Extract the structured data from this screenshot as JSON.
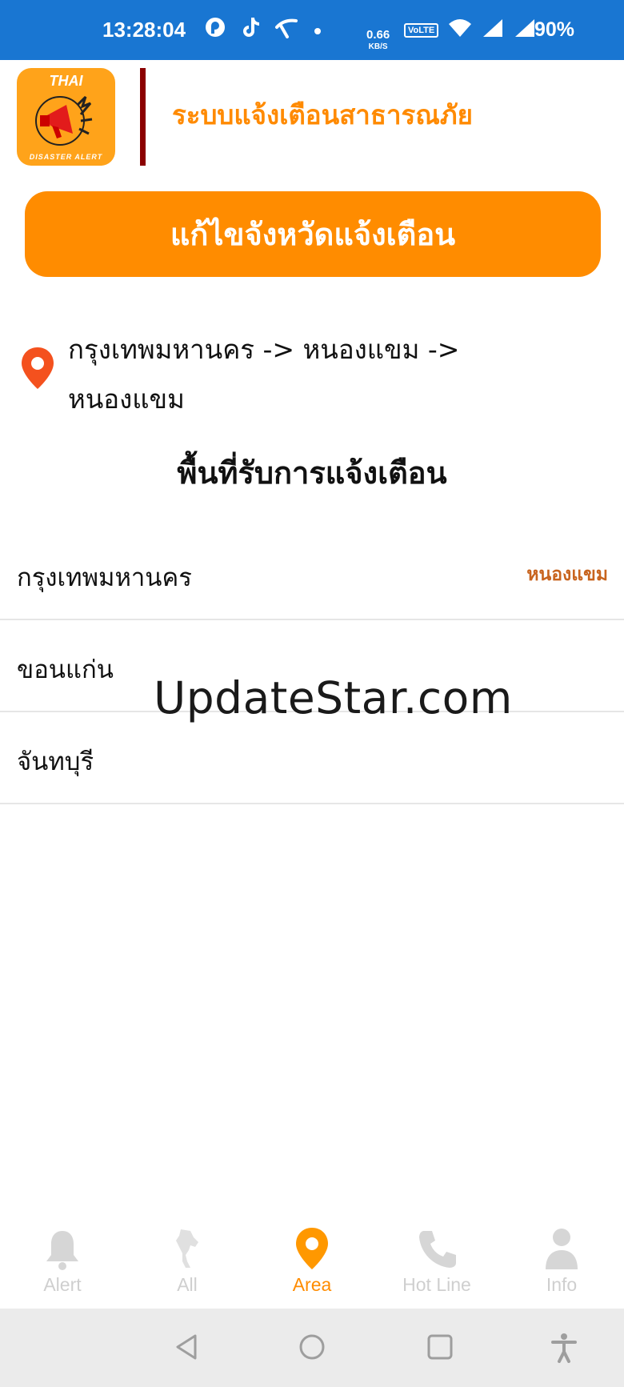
{
  "status_bar": {
    "time": "13:28:04",
    "net_speed_value": "0.66",
    "net_speed_unit": "KB/S",
    "volte_label": "VoLTE",
    "battery": "90%"
  },
  "header": {
    "logo_top_text": "THAI",
    "logo_bottom_text": "DISASTER ALERT",
    "app_title": "ระบบแจ้งเตือนสาธารณภัย"
  },
  "edit_button_label": "แก้ไขจังหวัดแจ้งเตือน",
  "location": {
    "path_text": "กรุงเทพมหานคร -> หนองแขม -> หนองแขม"
  },
  "section_title": "พื้นที่รับการแจ้งเตือน",
  "provinces": [
    {
      "name": "กรุงเทพมหานคร",
      "district": "หนองแขม"
    },
    {
      "name": "ขอนแก่น",
      "district": ""
    },
    {
      "name": "จันทบุรี",
      "district": ""
    }
  ],
  "watermark": "UpdateStar.com",
  "bottom_nav": [
    {
      "label": "Alert",
      "icon": "bell-icon",
      "active": false
    },
    {
      "label": "All",
      "icon": "thailand-map-icon",
      "active": false
    },
    {
      "label": "Area",
      "icon": "location-pin-icon",
      "active": true
    },
    {
      "label": "Hot Line",
      "icon": "phone-icon",
      "active": false
    },
    {
      "label": "Info",
      "icon": "person-icon",
      "active": false
    }
  ],
  "colors": {
    "status_bar": "#1976d2",
    "accent_orange": "#ff8c00",
    "title_orange": "#ff8a00",
    "divider_red": "#8b0000",
    "district_brown": "#c8641e",
    "inactive_gray": "#cfcfcf"
  }
}
